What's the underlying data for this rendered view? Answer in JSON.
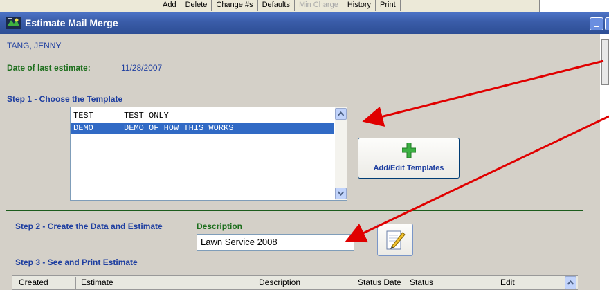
{
  "toolbar": {
    "buttons": [
      {
        "label": "Add",
        "enabled": true
      },
      {
        "label": "Delete",
        "enabled": true
      },
      {
        "label": "Change #s",
        "enabled": true
      },
      {
        "label": "Defaults",
        "enabled": true
      },
      {
        "label": "Min Charge",
        "enabled": false
      },
      {
        "label": "History",
        "enabled": true
      },
      {
        "label": "Print",
        "enabled": true
      }
    ]
  },
  "window": {
    "title": "Estimate Mail Merge"
  },
  "customer": {
    "name": "TANG, JENNY",
    "last_estimate_label": "Date of last estimate:",
    "last_estimate_date": "11/28/2007"
  },
  "step1": {
    "heading": "Step 1 - Choose the Template",
    "templates": [
      {
        "code": "TEST",
        "description": "TEST ONLY",
        "selected": false
      },
      {
        "code": "DEMO",
        "description": "DEMO OF HOW THIS WORKS",
        "selected": true
      }
    ],
    "add_edit_label": "Add/Edit Templates"
  },
  "step2": {
    "heading": "Step 2 - Create the Data and Estimate",
    "description_label": "Description",
    "description_value": "Lawn Service 2008"
  },
  "step3": {
    "heading": "Step 3 - See and Print Estimate",
    "columns": [
      "Created",
      "Estimate",
      "Description",
      "Status Date",
      "Status",
      "Edit"
    ]
  },
  "colors": {
    "title_bar": "#3a5ca8",
    "selection": "#316ac5",
    "heading_green": "#1c6e1c",
    "heading_blue": "#1f3fa0",
    "annotation_arrow": "#e00000"
  },
  "icons": {
    "title": "app-icon",
    "add_template": "plus-icon",
    "edit_description": "pencil-icon"
  }
}
